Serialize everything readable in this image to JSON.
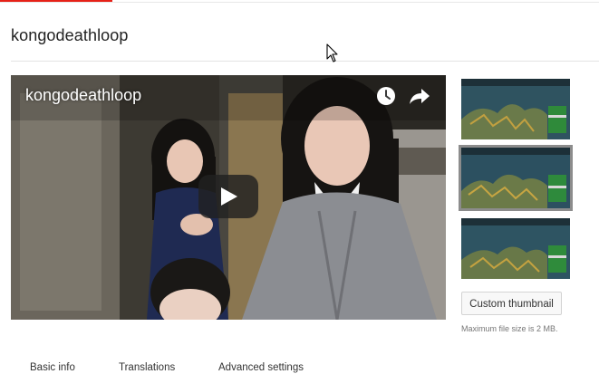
{
  "page": {
    "title": "kongodeathloop"
  },
  "player": {
    "video_title": "kongodeathloop",
    "icons": [
      "watch-later-icon",
      "share-icon",
      "play-icon"
    ]
  },
  "thumbnails": {
    "options": [
      {
        "selected": false
      },
      {
        "selected": true
      },
      {
        "selected": false
      }
    ],
    "custom_button_label": "Custom thumbnail",
    "file_size_note": "Maximum file size is 2 MB."
  },
  "tabs": [
    {
      "label": "Basic info"
    },
    {
      "label": "Translations"
    },
    {
      "label": "Advanced settings"
    }
  ],
  "colors": {
    "accent": "#e62117",
    "thumb_selected_border": "#8c8c8c"
  }
}
